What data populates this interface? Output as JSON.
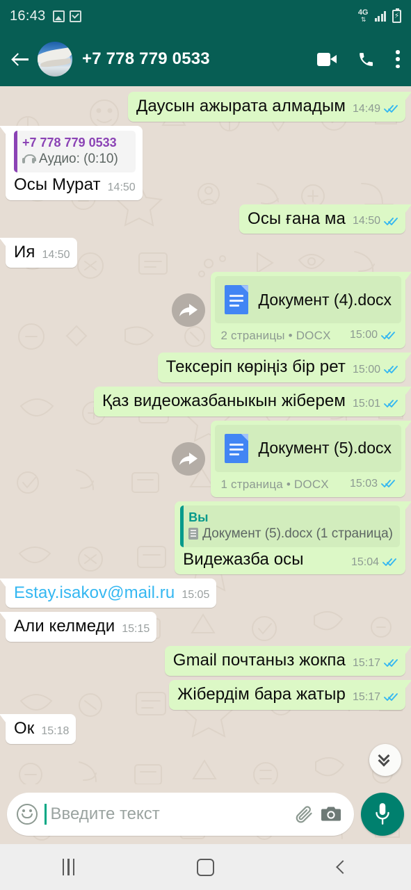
{
  "status_bar": {
    "time": "16:43",
    "icons": [
      "image-icon",
      "checkbox-icon"
    ],
    "network_label": "4G",
    "network_arrows": "⇅",
    "signal": "signal-bars-icon",
    "battery": "battery-charging-icon"
  },
  "header": {
    "back_icon": "back-arrow-icon",
    "avatar": "contact-avatar",
    "title": "+7 778 779 0533",
    "video_call_icon": "video-call-icon",
    "voice_call_icon": "voice-call-icon",
    "overflow_icon": "more-options-icon"
  },
  "messages": [
    {
      "id": "m1",
      "direction": "out",
      "type": "text",
      "text": "Даусын ажырата алмадым",
      "time": "14:49",
      "status": "read"
    },
    {
      "id": "m2",
      "direction": "in",
      "type": "text-with-quote",
      "quote": {
        "accent": "purple",
        "name": "+7 778 779 0533",
        "icon": "headphones-icon",
        "body": "Аудио: (0:10)"
      },
      "text": "Осы Мурат",
      "time": "14:50",
      "status": "none"
    },
    {
      "id": "m3",
      "direction": "out",
      "type": "text",
      "text": "Осы ғана ма",
      "time": "14:50",
      "status": "read"
    },
    {
      "id": "m4",
      "direction": "in",
      "type": "text",
      "text": "Ия",
      "time": "14:50",
      "status": "none"
    },
    {
      "id": "m5",
      "direction": "out",
      "type": "document",
      "forwarded": true,
      "forward_icon": "forward-arrow-icon",
      "doc_icon": "docx-file-icon",
      "filename": "Документ (4).docx",
      "subtitle": "2 страницы • DOCX",
      "time": "15:00",
      "status": "read"
    },
    {
      "id": "m6",
      "direction": "out",
      "type": "text",
      "text": "Тексеріп көріңіз бір рет",
      "time": "15:00",
      "status": "read"
    },
    {
      "id": "m7",
      "direction": "out",
      "type": "text",
      "text": "Қаз видеожазбаныкын жіберем",
      "time": "15:01",
      "status": "read"
    },
    {
      "id": "m8",
      "direction": "out",
      "type": "document",
      "forwarded": true,
      "forward_icon": "forward-arrow-icon",
      "doc_icon": "docx-file-icon",
      "filename": "Документ (5).docx",
      "subtitle": "1 страница • DOCX",
      "time": "15:03",
      "status": "read"
    },
    {
      "id": "m9",
      "direction": "out",
      "type": "text-with-quote",
      "quote": {
        "accent": "teal",
        "name": "Вы",
        "icon": "document-icon",
        "body": "Документ (5).docx (1 страница)"
      },
      "text": "Видежазба осы",
      "time": "15:04",
      "status": "read"
    },
    {
      "id": "m10",
      "direction": "in",
      "type": "link",
      "text": "Estay.isakov@mail.ru",
      "time": "15:05",
      "status": "none"
    },
    {
      "id": "m11",
      "direction": "in",
      "type": "text",
      "text": "Али келмеди",
      "time": "15:15",
      "status": "none"
    },
    {
      "id": "m12",
      "direction": "out",
      "type": "text",
      "text": "Gmail почтаныз жокпа",
      "time": "15:17",
      "status": "read"
    },
    {
      "id": "m13",
      "direction": "out",
      "type": "text",
      "text": "Жібердім бара жатыр",
      "time": "15:17",
      "status": "read"
    },
    {
      "id": "m14",
      "direction": "in",
      "type": "text",
      "text": "Ок",
      "time": "15:18",
      "status": "none"
    }
  ],
  "scroll_to_bottom": {
    "icon": "double-chevron-down-icon"
  },
  "composer": {
    "emoji_icon": "emoji-smiley-icon",
    "placeholder": "Введите текст",
    "value": "",
    "attach_icon": "paperclip-icon",
    "camera_icon": "camera-icon",
    "mic_icon": "microphone-icon"
  },
  "navigation": {
    "recents_icon": "recent-apps-icon",
    "home_icon": "home-icon",
    "back_icon": "back-icon"
  },
  "colors": {
    "header_green": "#075e54",
    "outgoing_bubble": "#dcf8c6",
    "incoming_bubble": "#ffffff",
    "chat_background": "#e6ddd4",
    "tick_blue": "#34b7f1",
    "link_blue": "#34b7f1",
    "quote_purple": "#8b43b5",
    "quote_teal": "#079a8b",
    "mic_green": "#00806e"
  }
}
